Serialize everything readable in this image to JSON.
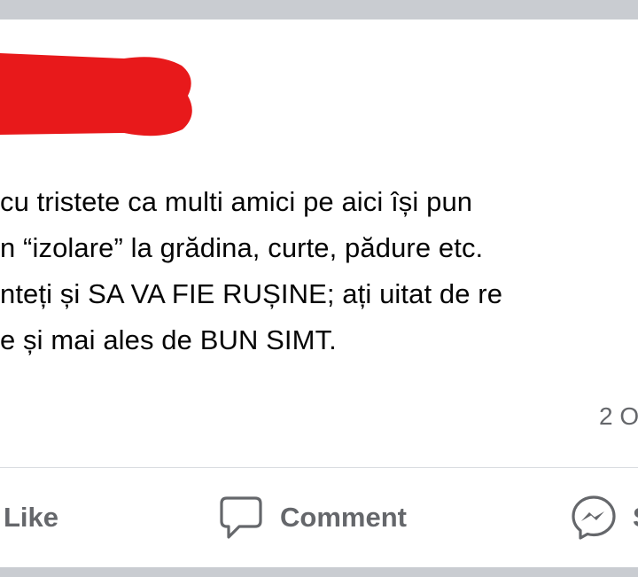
{
  "post": {
    "lines": [
      " cu tristete ca multi amici pe aici își pun",
      "n “izolare” la grădina, curte, pădure etc.",
      "nteți și SA VA FIE RUȘINE; ați uitat de re",
      "e și mai ales de BUN SIMT."
    ],
    "timestamp": "2 O",
    "redaction_color": "#e8191b"
  },
  "actions": {
    "like_label": "Like",
    "comment_label": "Comment",
    "share_label": "S"
  },
  "colors": {
    "background": "#c9ccd1",
    "card": "#ffffff",
    "text": "#050505",
    "muted": "#65676b"
  },
  "icons": [
    "comment-icon",
    "messenger-icon"
  ]
}
